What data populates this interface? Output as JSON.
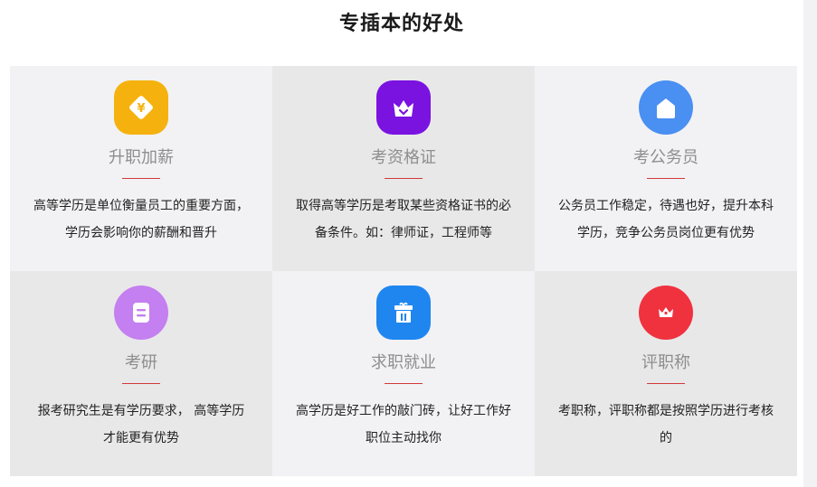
{
  "section": {
    "title": "专插本的好处"
  },
  "cards": [
    {
      "title": "升职加薪",
      "desc": "高等学历是单位衡量员工的重要方面，学历会影响你的薪酬和晋升",
      "icon": "yen-diamond-icon",
      "color": "#f5b20e"
    },
    {
      "title": "考资格证",
      "desc": "取得高等学历是考取某些资格证书的必备条件。如：律师证，工程师等",
      "icon": "crown-basket-icon",
      "color": "#7a12e0"
    },
    {
      "title": "考公务员",
      "desc": "公务员工作稳定，待遇也好，提升本科学历，竞争公务员岗位更有优势",
      "icon": "house-icon",
      "color": "#4a8ff2"
    },
    {
      "title": "考研",
      "desc": "报考研究生是有学历要求， 高等学历才能更有优势",
      "icon": "document-icon",
      "color": "#c47ff0"
    },
    {
      "title": "求职就业",
      "desc": "高学历是好工作的敲门砖，让好工作好职位主动找你",
      "icon": "gift-box-icon",
      "color": "#1f86f0"
    },
    {
      "title": "评职称",
      "desc": "考职称，评职称都是按照学历进行考核的",
      "icon": "crown-icon",
      "color": "#f0323f"
    }
  ]
}
